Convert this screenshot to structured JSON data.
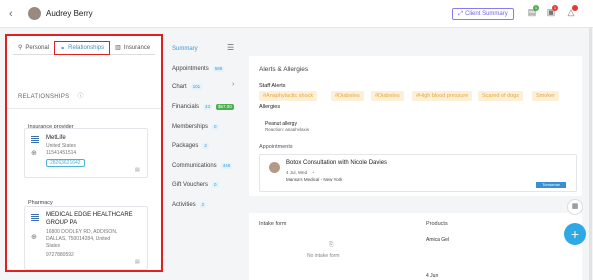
{
  "header": {
    "back": "‹",
    "client_name": "Audrey Berry",
    "client_summary_label": "Client Summary",
    "badge_counts": [
      "1",
      "1"
    ]
  },
  "left_panel": {
    "tabs": [
      {
        "label": "Personal",
        "icon": "person-icon"
      },
      {
        "label": "Relationships",
        "icon": "link-icon"
      },
      {
        "label": "Insurance",
        "icon": "building-icon"
      }
    ],
    "relationships_title": "RELATIONSHIPS",
    "insurance_section_label": "Insurance provider",
    "insurance": {
      "name": "MetLife",
      "country": "United States",
      "code": "11541451514",
      "phone": "28263621642"
    },
    "pharmacy_section_label": "Pharmacy",
    "pharmacy": {
      "name_line1": "MEDICAL EDGE HEALTHCARE",
      "name_line2": "GROUP PA",
      "address_line1": "16800 DOOLEY RD, ADDISON,",
      "address_line2": "DALLAS, 750014284, United",
      "address_line3": "States",
      "phone": "9727880592"
    }
  },
  "mid_nav": {
    "items": [
      {
        "label": "Summary",
        "count": ""
      },
      {
        "label": "Appointments",
        "count": "586"
      },
      {
        "label": "Chart",
        "count": "101"
      },
      {
        "label": "Financials",
        "count": "43",
        "money": "$67.00"
      },
      {
        "label": "Memberships",
        "count": "0"
      },
      {
        "label": "Packages",
        "count": "2"
      },
      {
        "label": "Communications",
        "count": "448"
      },
      {
        "label": "Gift Vouchers",
        "count": "0"
      },
      {
        "label": "Activities",
        "count": "2"
      }
    ]
  },
  "right": {
    "alerts_title": "Alerts & Allergies",
    "staff_alerts_label": "Staff Alerts",
    "staff_alerts": [
      "#Anaphylactic shock",
      "#Diabetes",
      "#Diabetes",
      "#High blood pressure",
      "Scared of dogs",
      "Smoker"
    ],
    "allergies_label": "Allergies",
    "allergy_name": "Peanut allergy",
    "allergy_reaction": "Reaction: anaphylaxis",
    "appointments_label": "Appointments",
    "appointment": {
      "title": "Botox Consultation with Nicole Davies",
      "date": "4 Jul, Wed",
      "location": "Mansa's Medical - New York",
      "status": "Tomorrow"
    },
    "intake_label": "Intake form",
    "no_intake": "No intake form",
    "products_label": "Products",
    "product_name": "Amica Gel",
    "product_date": "4 Jun"
  }
}
